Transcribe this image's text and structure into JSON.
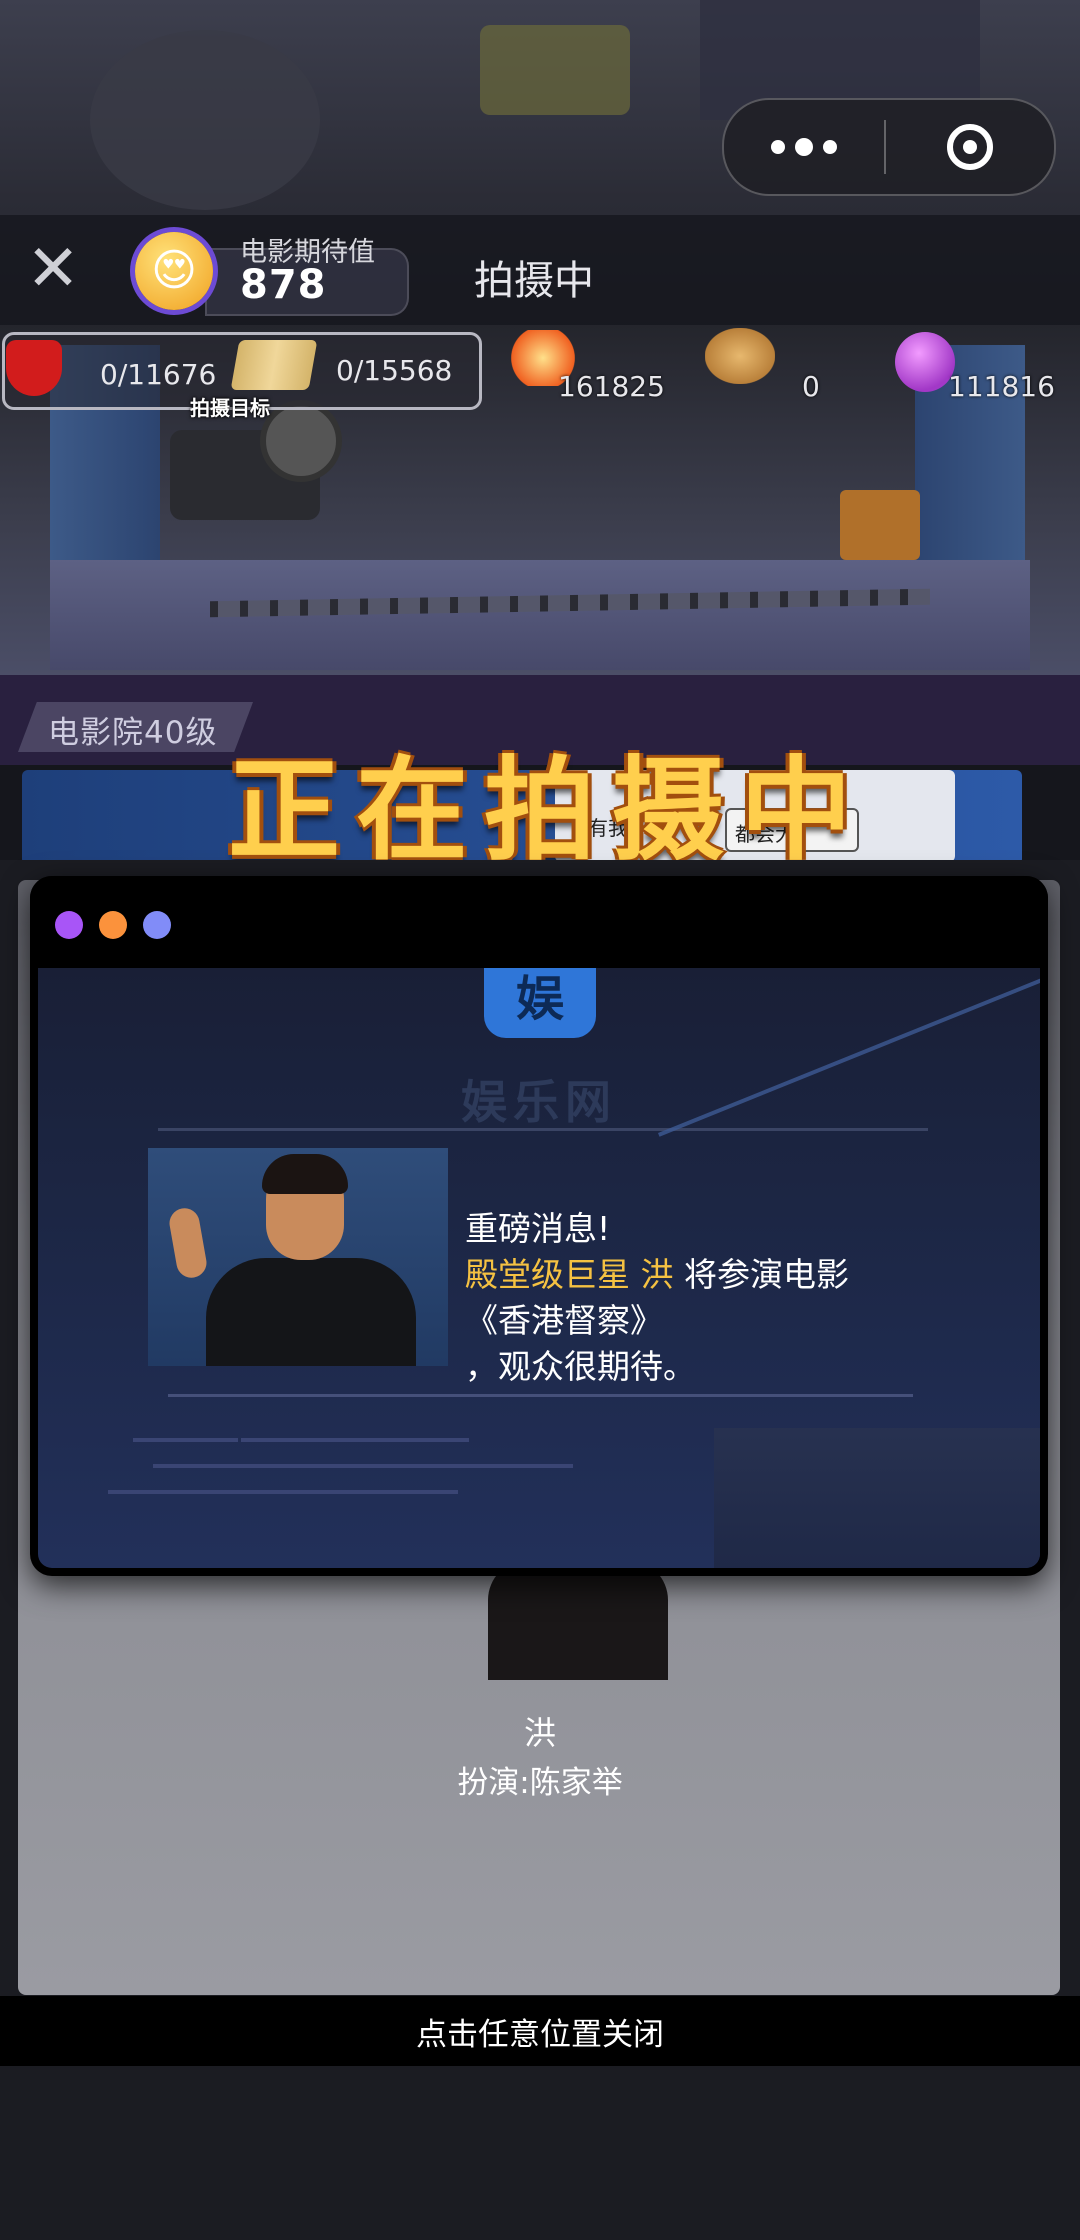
{
  "miniprogram": {
    "more_label": "more",
    "target_label": "close-miniprogram"
  },
  "header": {
    "expectation_label": "电影期待值",
    "expectation_value": "878",
    "title": "拍摄中"
  },
  "stats": {
    "red_progress": "0/11676",
    "book_progress": "0/15568",
    "goal_label": "拍摄目标",
    "explosion": "161825",
    "palette": "0",
    "gem": "111816"
  },
  "cinema": {
    "level": "电影院40级",
    "banner": "正在拍摄中",
    "banner_sub1": "有我",
    "banner_sub2": "都会大"
  },
  "news": {
    "site_icon": "娱",
    "site_name": "娱乐网",
    "line1": "重磅消息!",
    "line2_highlight": "殿堂级巨星 洪",
    "line2_rest": " 将参演电影",
    "line3": "《香港督察》",
    "line4": "，观众很期待。"
  },
  "character": {
    "name": "洪",
    "role": "扮演:陈家举"
  },
  "close_hint": "点击任意位置关闭",
  "colors": {
    "dot_purple": "#a855f7",
    "dot_orange": "#fb923c",
    "dot_indigo": "#818cf8",
    "highlight": "#f5c242",
    "banner_gold": "#ffcf4d"
  }
}
